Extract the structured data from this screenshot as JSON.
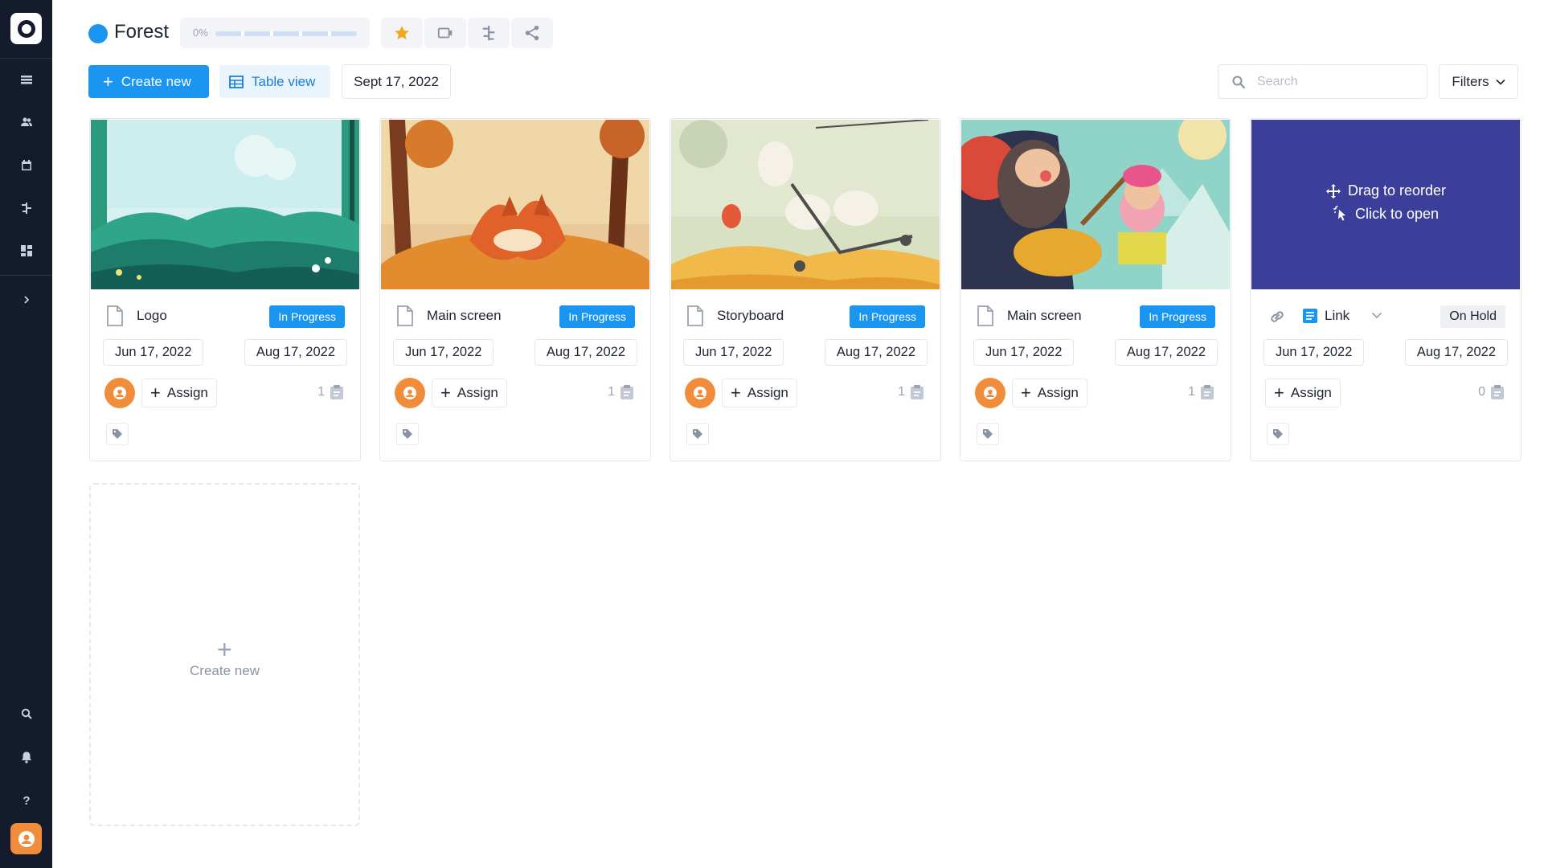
{
  "project": {
    "name": "Forest",
    "progress_text": "0%",
    "progress": 0
  },
  "toolbar": {
    "create_label": "Create new",
    "view_label": "Table view",
    "date_label": "Sept 17, 2022",
    "filters_label": "Filters"
  },
  "search": {
    "placeholder": "Search",
    "value": ""
  },
  "colors": {
    "accent": "#1a96f0",
    "sidebar": "#141b2d",
    "avatar": "#f08c3a",
    "overlay": "#3c3f9a"
  },
  "sidebar": {
    "items": [
      "grid-icon",
      "users-icon",
      "calendar-icon",
      "timeline-icon",
      "dashboard-icon",
      "chevron-right-icon"
    ],
    "bottom": [
      "search-icon",
      "bell-icon",
      "help-icon",
      "user-avatar"
    ]
  },
  "cards": [
    {
      "title": "Logo",
      "status": "In Progress",
      "start": "Jun 17, 2022",
      "end": "Aug 17, 2022",
      "assign": "Assign",
      "count": "1"
    },
    {
      "title": "Main screen",
      "status": "In Progress",
      "start": "Jun 17, 2022",
      "end": "Aug 17, 2022",
      "assign": "Assign",
      "count": "1"
    },
    {
      "title": "Storyboard",
      "status": "In Progress",
      "start": "Jun 17, 2022",
      "end": "Aug 17, 2022",
      "assign": "Assign",
      "count": "1"
    },
    {
      "title": "Main screen",
      "status": "In Progress",
      "start": "Jun 17, 2022",
      "end": "Aug 17, 2022",
      "assign": "Assign",
      "count": "1"
    },
    {
      "title": "Link",
      "status": "On Hold",
      "start": "Jun 17, 2022",
      "end": "Aug 17, 2022",
      "assign": "Assign",
      "count": "0",
      "overlay": {
        "drag": "Drag to reorder",
        "open": "Click to open"
      }
    }
  ],
  "create_card": {
    "label": "Create new"
  }
}
